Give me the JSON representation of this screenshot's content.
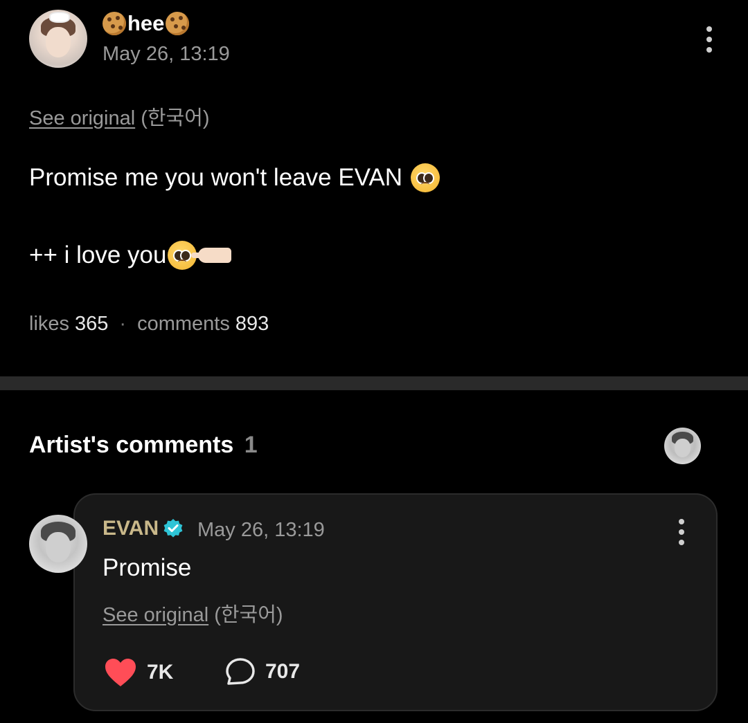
{
  "post": {
    "author": {
      "name": "hee",
      "avatar": "user-avatar"
    },
    "date": "May 26, 13:19",
    "see_original": {
      "link_label": "See original",
      "language": "(한국어)"
    },
    "body_line_1": "Promise me you won't leave EVAN",
    "body_line_2": "++ i love you",
    "stats": {
      "likes_label": "likes",
      "likes_count": "365",
      "separator": "·",
      "comments_label": "comments",
      "comments_count": "893"
    }
  },
  "artist_comments": {
    "title": "Artist's comments",
    "count": "1",
    "comment": {
      "author": "EVAN",
      "verified": true,
      "date": "May 26, 13:19",
      "text": "Promise",
      "see_original": {
        "link_label": "See original",
        "language": "(한국어)"
      },
      "likes": "7K",
      "replies": "707"
    }
  },
  "colors": {
    "background": "#000000",
    "card": "#181818",
    "artist_name": "#c9b88a",
    "verified_badge": "#2ec4d6",
    "heart": "#ff4d57",
    "muted_text": "#9a9a9a"
  },
  "icons": [
    "cookie-emoji",
    "more-options-icon",
    "pleading-face-emoji",
    "pointing-hand-emoji",
    "verified-badge-icon",
    "heart-icon",
    "comment-bubble-icon"
  ]
}
